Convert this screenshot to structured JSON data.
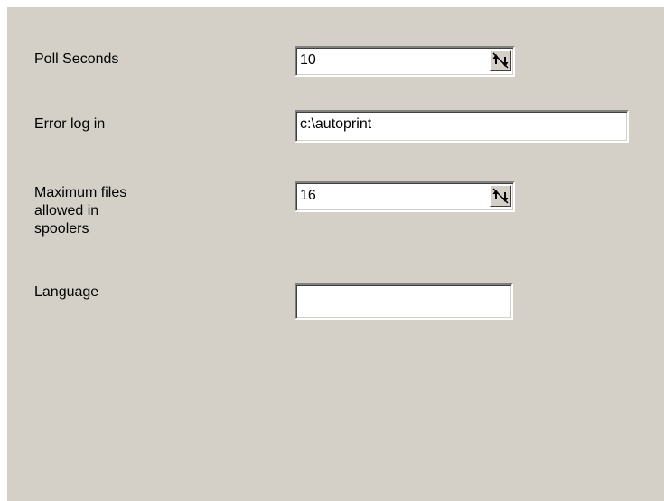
{
  "settings": {
    "poll_seconds": {
      "label": "Poll Seconds",
      "value": "10",
      "spinner_icon": "up-down-arrows-icon"
    },
    "error_log": {
      "label": "Error log in",
      "value": "c:\\autoprint"
    },
    "max_files": {
      "label": "Maximum files\nallowed in\nspoolers",
      "value": "16",
      "spinner_icon": "up-down-arrows-icon"
    },
    "language": {
      "label": "Language",
      "value": ""
    }
  }
}
